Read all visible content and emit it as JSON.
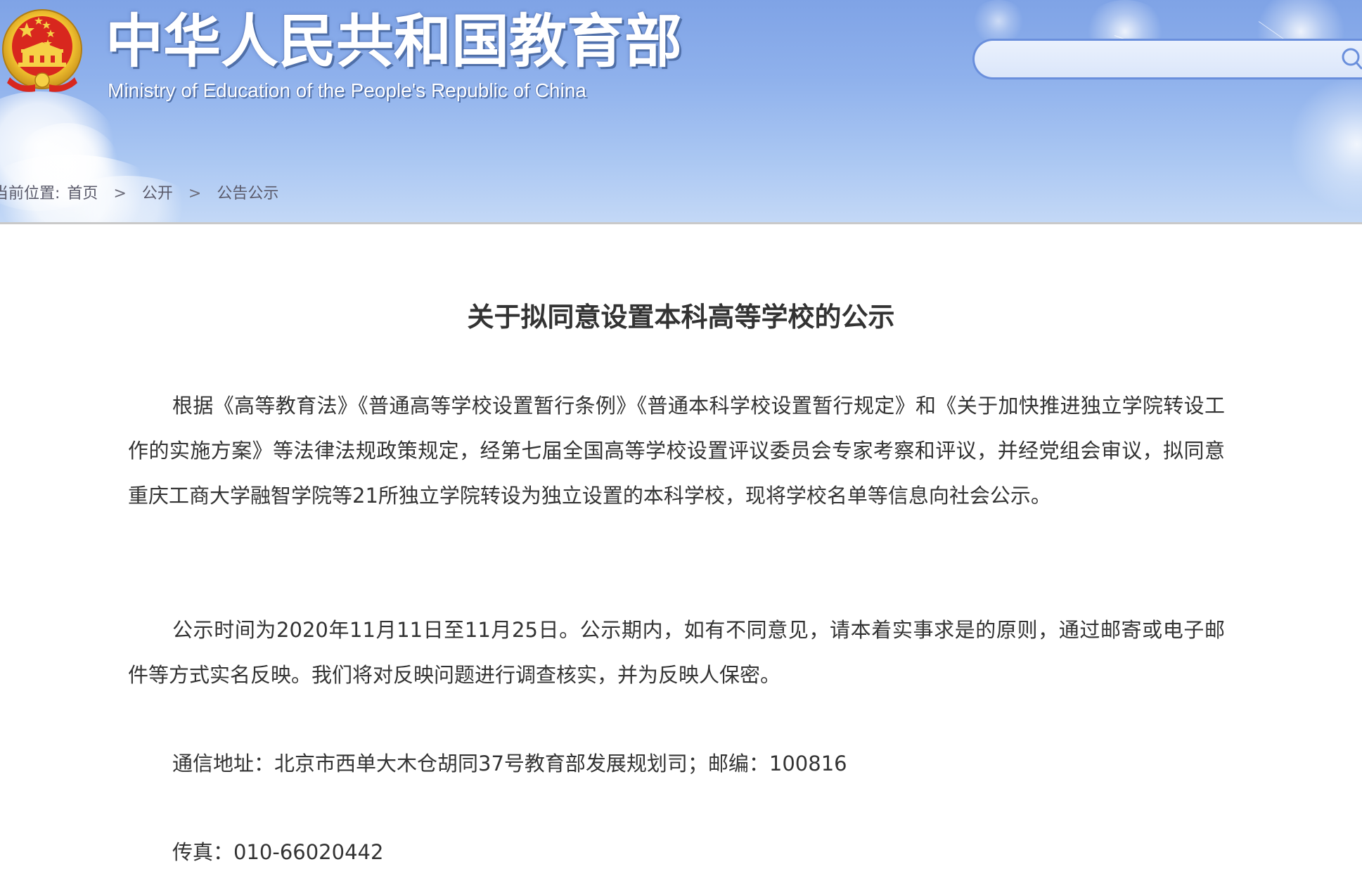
{
  "header": {
    "ministry_name_cn": "中华人民共和国教育部",
    "ministry_name_en": "Ministry of Education of the People's Republic of China",
    "search": {
      "value": "",
      "placeholder": ""
    },
    "colors": {
      "banner_top": "#7fa3e6",
      "banner_bottom": "#c3d8f6",
      "search_border": "#6a8fdc",
      "emblem_red": "#d8271e",
      "emblem_gold": "#f2c230"
    }
  },
  "breadcrumb": {
    "label": "当前位置:",
    "items": [
      "首页",
      "公开",
      "公告公示"
    ],
    "separator": ">"
  },
  "article": {
    "title": "关于拟同意设置本科高等学校的公示",
    "paragraphs": [
      "根据《高等教育法》《普通高等学校设置暂行条例》《普通本科学校设置暂行规定》和《关于加快推进独立学院转设工作的实施方案》等法律法规政策规定，经第七届全国高等学校设置评议委员会专家考察和评议，并经党组会审议，拟同意重庆工商大学融智学院等21所独立学院转设为独立设置的本科学校，现将学校名单等信息向社会公示。",
      "公示时间为2020年11月11日至11月25日。公示期内，如有不同意见，请本着实事求是的原则，通过邮寄或电子邮件等方式实名反映。我们将对反映问题进行调查核实，并为反映人保密。",
      "通信地址：北京市西单大木仓胡同37号教育部发展规划司；邮编：100816",
      "传真：010-66020442"
    ],
    "text_color": "#333333"
  },
  "icons": {
    "emblem": "national-emblem-icon",
    "search": "search-icon"
  }
}
